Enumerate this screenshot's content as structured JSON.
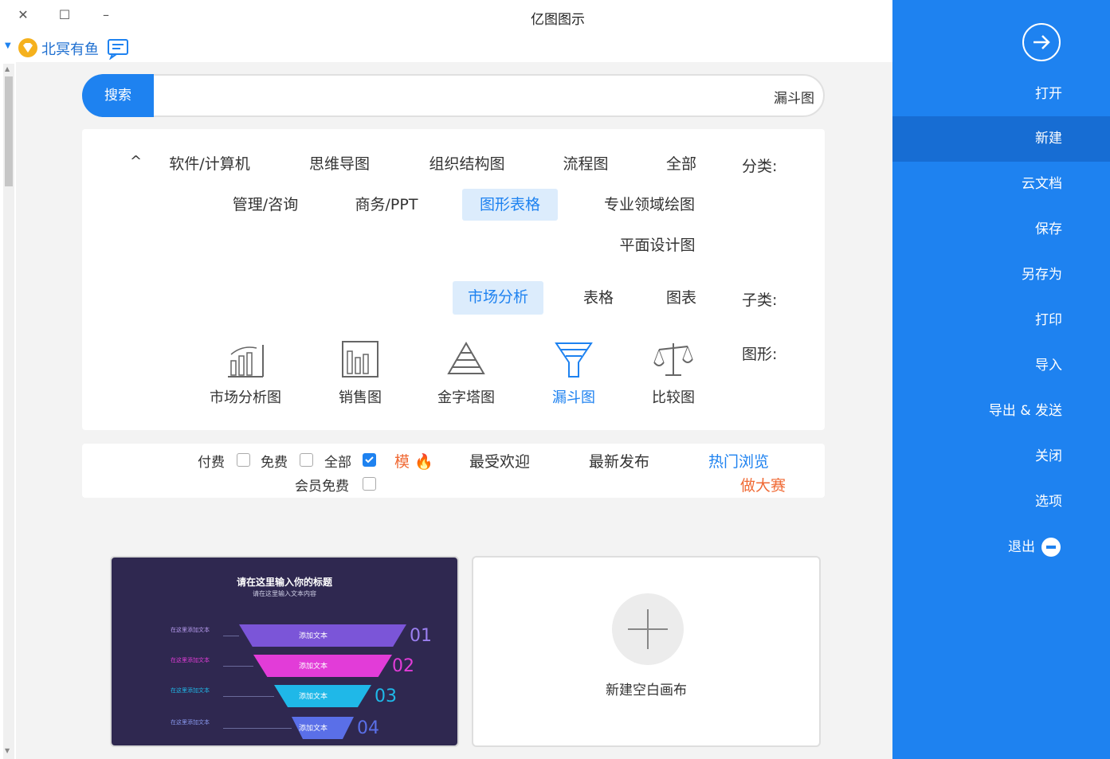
{
  "app": {
    "title": "亿图图示",
    "window_buttons": [
      "minimize",
      "maximize",
      "close"
    ]
  },
  "user": {
    "name": "北冥有鱼",
    "badge_icon": "vip-diamond-icon",
    "message_icon": "message-icon"
  },
  "sidebar": {
    "items": [
      {
        "label": "打开",
        "icon": "arrow-right-circle-icon"
      },
      {
        "label": "新建",
        "active": true
      },
      {
        "label": "云文档"
      },
      {
        "label": "保存"
      },
      {
        "label": "另存为"
      },
      {
        "label": "打印"
      },
      {
        "label": "导入"
      },
      {
        "label": "导出 & 发送"
      },
      {
        "label": "关闭"
      },
      {
        "label": "选项"
      },
      {
        "label": "退出",
        "icon": "minus-circle-icon"
      }
    ],
    "color": "#1e82f0"
  },
  "search": {
    "button_label": "搜索",
    "value": "漏斗图"
  },
  "filters": {
    "category_label": "分类:",
    "categories": [
      "全部",
      "流程图",
      "组织结构图",
      "思维导图",
      "软件/计算机",
      "专业领域绘图",
      "图形表格",
      "商务/PPT",
      "管理/咨询",
      "平面设计图"
    ],
    "category_selected": "图形表格",
    "subcategory_label": "子类:",
    "subcategories": [
      "图表",
      "表格",
      "市场分析"
    ],
    "subcategory_selected": "市场分析",
    "shape_label": "图形:",
    "shapes": [
      {
        "name": "比较图",
        "icon": "balance-scale-icon"
      },
      {
        "name": "漏斗图",
        "icon": "funnel-icon"
      },
      {
        "name": "金字塔图",
        "icon": "pyramid-icon"
      },
      {
        "name": "销售图",
        "icon": "bar-chart-icon"
      },
      {
        "name": "市场分析图",
        "icon": "market-chart-icon"
      }
    ],
    "shape_selected": "漏斗图"
  },
  "sort": {
    "options": [
      "热门浏览",
      "最新发布",
      "最受欢迎"
    ],
    "selected": "热门浏览",
    "contest_label": "做大赛",
    "hot_label": "模",
    "checkboxes": [
      {
        "label": "全部",
        "checked": true
      },
      {
        "label": "免费",
        "checked": false
      },
      {
        "label": "付费",
        "checked": false
      },
      {
        "label": "会员免费",
        "checked": false
      }
    ],
    "accent": "#1e82f0",
    "hot_color": "#f06a35"
  },
  "cards": {
    "template": {
      "heading": "请在这里输入你的标题",
      "subheading": "请在这里输入文本内容",
      "levels": [
        {
          "num": "01",
          "label": "添加文本",
          "color": "#7b55d8"
        },
        {
          "num": "02",
          "label": "添加文本",
          "color": "#e23cd8"
        },
        {
          "num": "03",
          "label": "添加文本",
          "color": "#1fb8e8"
        },
        {
          "num": "04",
          "label": "添加文本",
          "color": "#5a6fe8"
        }
      ],
      "side_text": "在这里添加文本",
      "background": "#2f2850"
    },
    "blank": {
      "label": "新建空白画布"
    }
  }
}
